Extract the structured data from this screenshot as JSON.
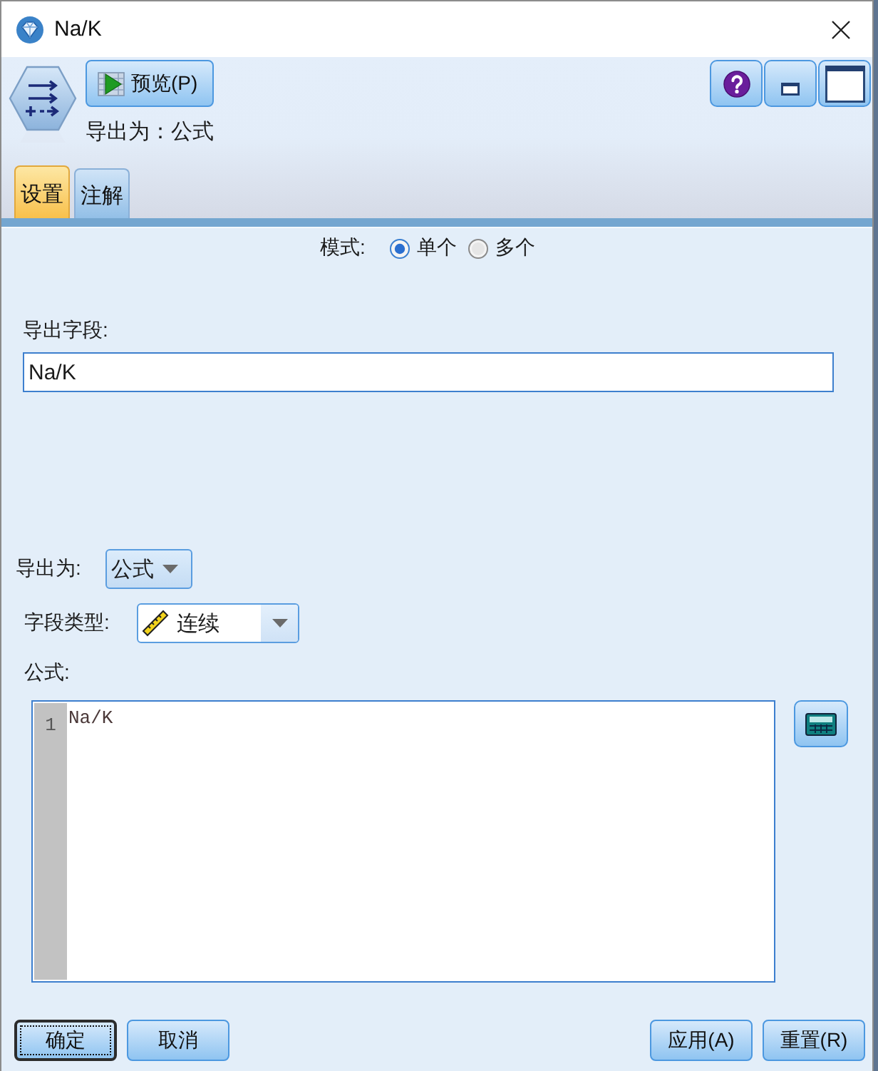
{
  "window": {
    "title": "Na/K"
  },
  "header": {
    "preview_button": "预览(P)",
    "subtitle": "导出为：公式"
  },
  "tabs": [
    {
      "label": "设置",
      "selected": true
    },
    {
      "label": "注解",
      "selected": false
    }
  ],
  "mode": {
    "label": "模式:",
    "options": [
      {
        "label": "单个",
        "selected": true
      },
      {
        "label": "多个",
        "selected": false
      }
    ]
  },
  "derive_field": {
    "label": "导出字段:",
    "value": "Na/K"
  },
  "derive_as": {
    "label": "导出为:",
    "value": "公式"
  },
  "field_type": {
    "label": "字段类型:",
    "value": "连续"
  },
  "formula": {
    "label": "公式:",
    "lines": [
      {
        "number": "1",
        "text": "Na/K"
      }
    ]
  },
  "left_buttons": [
    {
      "label": "确定",
      "default": true
    },
    {
      "label": "取消",
      "default": false
    }
  ],
  "right_buttons": [
    {
      "label": "应用(A)",
      "default": false
    },
    {
      "label": "重置(R)",
      "default": false
    }
  ]
}
